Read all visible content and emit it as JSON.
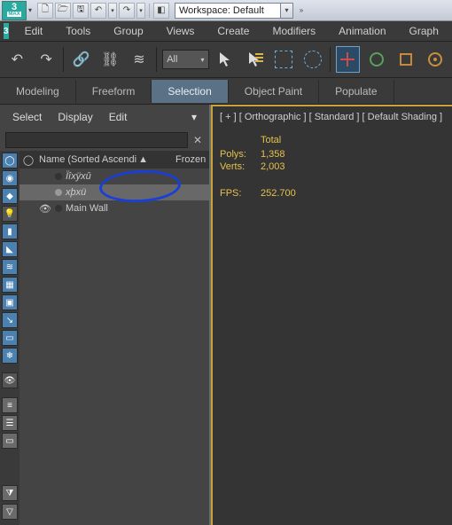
{
  "titlebar": {
    "logo_top": "3",
    "logo_bottom": "MAX",
    "workspace_label": "Workspace: Default"
  },
  "menus": {
    "edit": "Edit",
    "tools": "Tools",
    "group": "Group",
    "views": "Views",
    "create": "Create",
    "modifiers": "Modifiers",
    "animation": "Animation",
    "graph": "Graph"
  },
  "maintb": {
    "filter": "All"
  },
  "ribbon": {
    "modeling": "Modeling",
    "freeform": "Freeform",
    "selection": "Selection",
    "object_paint": "Object Paint",
    "populate": "Populate"
  },
  "scene_explorer": {
    "menus": {
      "select": "Select",
      "display": "Display",
      "edit": "Edit"
    },
    "search_placeholder": "",
    "header_name": "Name (Sorted Ascendi",
    "header_frozen": "Frozen",
    "items": [
      {
        "name": "Ïîxÿxû",
        "selected": false
      },
      {
        "name": "xþxü",
        "selected": true
      },
      {
        "name": "Main Wall",
        "selected": false
      }
    ]
  },
  "viewport": {
    "header": {
      "plus": "[ + ]",
      "view": "[ Orthographic ]",
      "shade1": "[ Standard ]",
      "shade2": "[ Default Shading ]"
    },
    "stats": {
      "total_label": "Total",
      "polys_label": "Polys:",
      "polys_value": "1,358",
      "verts_label": "Verts:",
      "verts_value": "2,003",
      "fps_label": "FPS:",
      "fps_value": "252.700"
    }
  }
}
